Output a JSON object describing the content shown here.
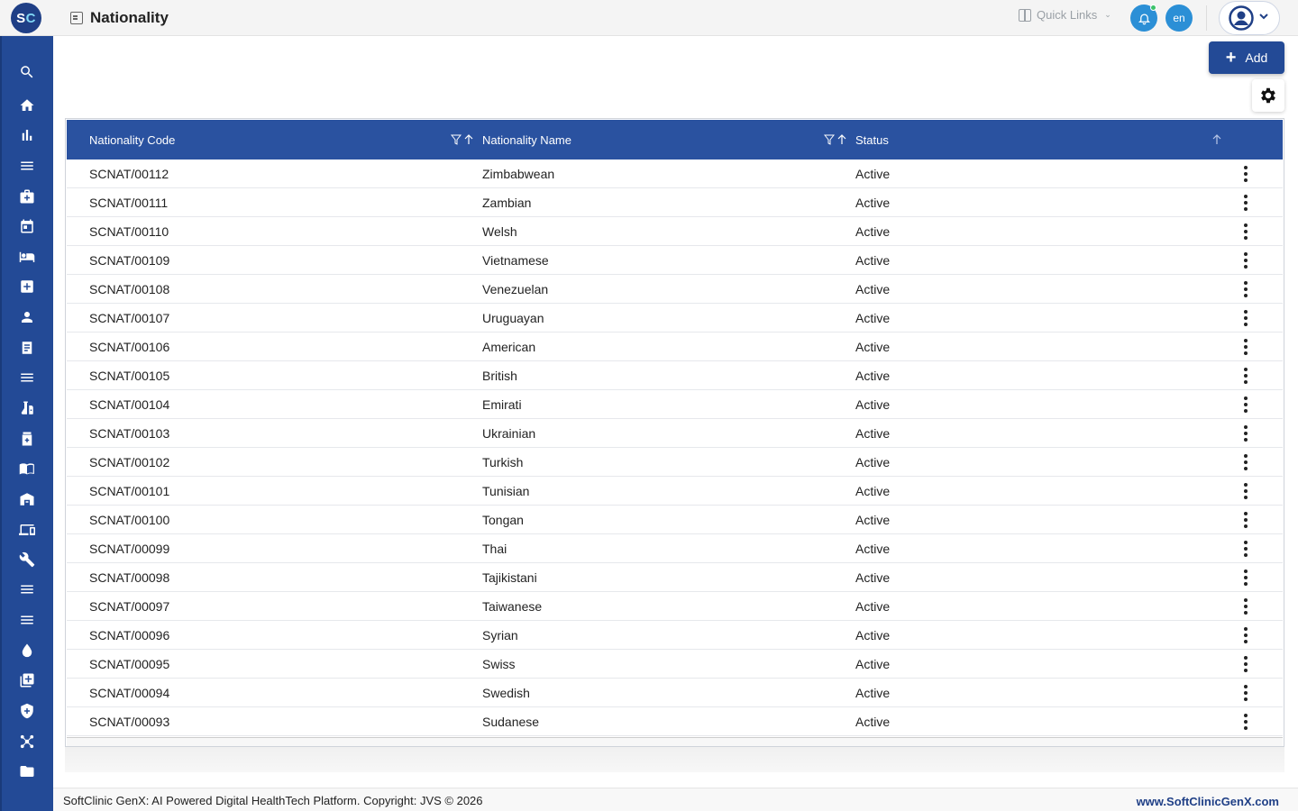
{
  "header": {
    "logo": {
      "s": "S",
      "c": "C"
    },
    "title": "Nationality",
    "quick_links": "Quick Links",
    "language": "en"
  },
  "toolbar": {
    "add_label": "Add"
  },
  "table": {
    "columns": [
      "Nationality Code",
      "Nationality Name",
      "Status"
    ],
    "rows": [
      {
        "code": "SCNAT/00112",
        "name": "Zimbabwean",
        "status": "Active"
      },
      {
        "code": "SCNAT/00111",
        "name": "Zambian",
        "status": "Active"
      },
      {
        "code": "SCNAT/00110",
        "name": "Welsh",
        "status": "Active"
      },
      {
        "code": "SCNAT/00109",
        "name": "Vietnamese",
        "status": "Active"
      },
      {
        "code": "SCNAT/00108",
        "name": "Venezuelan",
        "status": "Active"
      },
      {
        "code": "SCNAT/00107",
        "name": "Uruguayan",
        "status": "Active"
      },
      {
        "code": "SCNAT/00106",
        "name": "American",
        "status": "Active"
      },
      {
        "code": "SCNAT/00105",
        "name": "British",
        "status": "Active"
      },
      {
        "code": "SCNAT/00104",
        "name": "Emirati",
        "status": "Active"
      },
      {
        "code": "SCNAT/00103",
        "name": "Ukrainian",
        "status": "Active"
      },
      {
        "code": "SCNAT/00102",
        "name": "Turkish",
        "status": "Active"
      },
      {
        "code": "SCNAT/00101",
        "name": "Tunisian",
        "status": "Active"
      },
      {
        "code": "SCNAT/00100",
        "name": "Tongan",
        "status": "Active"
      },
      {
        "code": "SCNAT/00099",
        "name": "Thai",
        "status": "Active"
      },
      {
        "code": "SCNAT/00098",
        "name": "Tajikistani",
        "status": "Active"
      },
      {
        "code": "SCNAT/00097",
        "name": "Taiwanese",
        "status": "Active"
      },
      {
        "code": "SCNAT/00096",
        "name": "Syrian",
        "status": "Active"
      },
      {
        "code": "SCNAT/00095",
        "name": "Swiss",
        "status": "Active"
      },
      {
        "code": "SCNAT/00094",
        "name": "Swedish",
        "status": "Active"
      },
      {
        "code": "SCNAT/00093",
        "name": "Sudanese",
        "status": "Active"
      }
    ]
  },
  "sidebar": {
    "icons": [
      "search-icon",
      "home-icon",
      "bar-chart-icon",
      "menu-icon",
      "medical-bag-icon",
      "calendar-icon",
      "bed-icon",
      "hospital-plus-icon",
      "person-icon",
      "receipt-icon",
      "list-icon",
      "lab-icon",
      "pharmacy-icon",
      "book-icon",
      "warehouse-icon",
      "devices-icon",
      "wrench-icon",
      "menu-icon",
      "menu-icon",
      "drop-icon",
      "add-library-icon",
      "shield-icon",
      "hub-icon",
      "folder-icon"
    ]
  },
  "footer": {
    "copyright": "SoftClinic GenX: AI Powered Digital HealthTech Platform. Copyright: JVS © 2026",
    "website": "www.SoftClinicGenX.com"
  },
  "colors": {
    "primary": "#234a96",
    "header_row": "#2a52a0",
    "accent_blue": "#2b8fd6"
  }
}
